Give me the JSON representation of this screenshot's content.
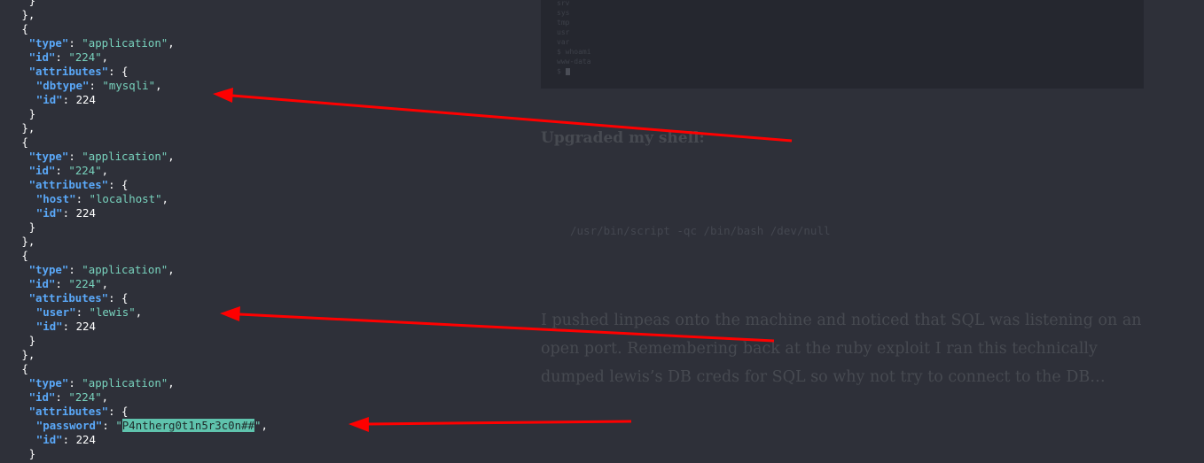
{
  "code_lines": [
    {
      "i": 3,
      "kind": "punct",
      "text": "}"
    },
    {
      "i": 2,
      "kind": "punct",
      "text": "},"
    },
    {
      "i": 2,
      "kind": "punct",
      "text": "{"
    },
    {
      "i": 3,
      "kind": "kv",
      "key": "\"type\"",
      "sep": ": ",
      "val": "\"application\"",
      "vt": "s",
      "tail": ","
    },
    {
      "i": 3,
      "kind": "kv",
      "key": "\"id\"",
      "sep": ": ",
      "val": "\"224\"",
      "vt": "s",
      "tail": ","
    },
    {
      "i": 3,
      "kind": "kv",
      "key": "\"attributes\"",
      "sep": ": ",
      "val": "{",
      "vt": "n",
      "tail": ""
    },
    {
      "i": 4,
      "kind": "kv",
      "key": "\"dbtype\"",
      "sep": ": ",
      "val": "\"mysqli\"",
      "vt": "s",
      "tail": ","
    },
    {
      "i": 4,
      "kind": "kv",
      "key": "\"id\"",
      "sep": ": ",
      "val": "224",
      "vt": "n",
      "tail": ""
    },
    {
      "i": 3,
      "kind": "punct",
      "text": "}"
    },
    {
      "i": 2,
      "kind": "punct",
      "text": "},"
    },
    {
      "i": 2,
      "kind": "punct",
      "text": "{"
    },
    {
      "i": 3,
      "kind": "kv",
      "key": "\"type\"",
      "sep": ": ",
      "val": "\"application\"",
      "vt": "s",
      "tail": ","
    },
    {
      "i": 3,
      "kind": "kv",
      "key": "\"id\"",
      "sep": ": ",
      "val": "\"224\"",
      "vt": "s",
      "tail": ","
    },
    {
      "i": 3,
      "kind": "kv",
      "key": "\"attributes\"",
      "sep": ": ",
      "val": "{",
      "vt": "n",
      "tail": ""
    },
    {
      "i": 4,
      "kind": "kv",
      "key": "\"host\"",
      "sep": ": ",
      "val": "\"localhost\"",
      "vt": "s",
      "tail": ","
    },
    {
      "i": 4,
      "kind": "kv",
      "key": "\"id\"",
      "sep": ": ",
      "val": "224",
      "vt": "n",
      "tail": ""
    },
    {
      "i": 3,
      "kind": "punct",
      "text": "}"
    },
    {
      "i": 2,
      "kind": "punct",
      "text": "},"
    },
    {
      "i": 2,
      "kind": "punct",
      "text": "{"
    },
    {
      "i": 3,
      "kind": "kv",
      "key": "\"type\"",
      "sep": ": ",
      "val": "\"application\"",
      "vt": "s",
      "tail": ","
    },
    {
      "i": 3,
      "kind": "kv",
      "key": "\"id\"",
      "sep": ": ",
      "val": "\"224\"",
      "vt": "s",
      "tail": ","
    },
    {
      "i": 3,
      "kind": "kv",
      "key": "\"attributes\"",
      "sep": ": ",
      "val": "{",
      "vt": "n",
      "tail": ""
    },
    {
      "i": 4,
      "kind": "kv",
      "key": "\"user\"",
      "sep": ": ",
      "val": "\"lewis\"",
      "vt": "s",
      "tail": ","
    },
    {
      "i": 4,
      "kind": "kv",
      "key": "\"id\"",
      "sep": ": ",
      "val": "224",
      "vt": "n",
      "tail": ""
    },
    {
      "i": 3,
      "kind": "punct",
      "text": "}"
    },
    {
      "i": 2,
      "kind": "punct",
      "text": "},"
    },
    {
      "i": 2,
      "kind": "punct",
      "text": "{"
    },
    {
      "i": 3,
      "kind": "kv",
      "key": "\"type\"",
      "sep": ": ",
      "val": "\"application\"",
      "vt": "s",
      "tail": ","
    },
    {
      "i": 3,
      "kind": "kv",
      "key": "\"id\"",
      "sep": ": ",
      "val": "\"224\"",
      "vt": "s",
      "tail": ","
    },
    {
      "i": 3,
      "kind": "kv",
      "key": "\"attributes\"",
      "sep": ": ",
      "val": "{",
      "vt": "n",
      "tail": ""
    },
    {
      "i": 4,
      "kind": "pw",
      "key": "\"password\"",
      "sep": ": ",
      "q": "\"",
      "val": "P4ntherg0t1n5r3c0n##",
      "tail": ","
    },
    {
      "i": 4,
      "kind": "kv",
      "key": "\"id\"",
      "sep": ": ",
      "val": "224",
      "vt": "n",
      "tail": ""
    },
    {
      "i": 3,
      "kind": "punct",
      "text": "}"
    }
  ],
  "terminal": {
    "lines": [
      "srv",
      "sys",
      "tmp",
      "usr",
      "var",
      "$ whoami",
      "www-data",
      "$ "
    ]
  },
  "article": {
    "heading": "Upgraded my shell:",
    "command": "/usr/bin/script -qc /bin/bash /dev/null",
    "paragraph_lines": [
      "I pushed linpeas onto the machine and noticed that SQL was listening on an",
      "open port. Remembering back at the ruby exploit I ran this technically",
      "dumped lewis’s DB creds for SQL so why not try to connect to the DB…"
    ]
  },
  "colors": {
    "background": "#2e3039",
    "json_key": "#5aa8f8",
    "json_string": "#78d2bd",
    "highlight": "#5fc3ad",
    "arrow": "#ff0000"
  }
}
